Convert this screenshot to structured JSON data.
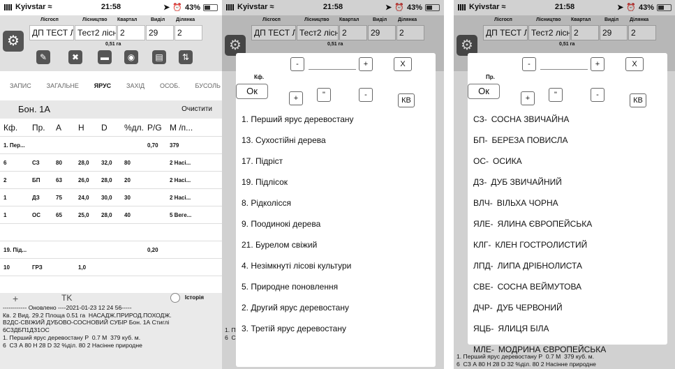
{
  "status": {
    "carrier": "Kyivstar",
    "time": "21:58",
    "battery": "43%"
  },
  "header": {
    "labels": [
      "Лісгосп",
      "Лісництво",
      "Квартал",
      "Виділ",
      "Ділянка"
    ],
    "values": [
      "ДП ТЕСТ Л",
      "Тест2 лісн",
      "2",
      "29",
      "2"
    ],
    "area": "0,51 га"
  },
  "tabs": [
    "ЗАПИС",
    "ЗАГАЛЬНЕ",
    "ЯРУС",
    "ЗАХІД",
    "ОСОБ.",
    "БУСОЛЬ"
  ],
  "stand": {
    "title": "Бон. 1А",
    "clear": "Очистити"
  },
  "grid": {
    "headers": [
      "Кф.",
      "Пр.",
      "А",
      "Н",
      "D",
      "%дл.",
      "P/G",
      "М /п..."
    ],
    "rows": [
      [
        "1. Пер...",
        "",
        "",
        "",
        "",
        "",
        "0,70",
        "379"
      ],
      [
        "6",
        "СЗ",
        "80",
        "28,0",
        "32,0",
        "80",
        "",
        "2 Насі..."
      ],
      [
        "2",
        "БП",
        "63",
        "26,0",
        "28,0",
        "20",
        "",
        "2 Насі..."
      ],
      [
        "1",
        "ДЗ",
        "75",
        "24,0",
        "30,0",
        "30",
        "",
        "2 Насі..."
      ],
      [
        "1",
        "ОС",
        "65",
        "25,0",
        "28,0",
        "40",
        "",
        "5 Веге..."
      ],
      [
        "",
        "",
        "",
        "",
        "",
        "",
        "",
        ""
      ],
      [
        "19. Під...",
        "",
        "",
        "",
        "",
        "",
        "0,20",
        ""
      ],
      [
        "10",
        "ГРЗ",
        "",
        "1,0",
        "",
        "",
        "",
        ""
      ]
    ]
  },
  "bottom": {
    "plus": "+",
    "tk": "TK",
    "history": "Історія",
    "log": [
      "------------ Оновлено ----2021-01-23 12 24 56-----",
      "Кв. 2 Вид. 29.2 Площа 0.51 га  НАСАДЖ.ПРИРОД.ПОХОДЖ.",
      "В2ДС-СВІЖИЙ ДУБОВО-СОСНОВИЙ СУБІР Бон. 1А Стиглі",
      "6С3ДБП1ДЗ1ОС",
      "1. Перший ярус деревостану Р  0.7 М  379 куб. м.",
      "6  СЗ А 80 Н 28 D 32 %діл. 80 2 Насінне природне"
    ]
  },
  "popup2": {
    "label": "Кф.",
    "ok": "Ок",
    "btn_minus": "-",
    "btn_plus": "+",
    "btn_x": "X",
    "btn_quote": "\"",
    "btn_kv": "КВ",
    "items": [
      "1. Перший ярус деревостану",
      "13. Сухостійні дерева",
      "17. Підріст",
      "19. Підлісок",
      "8. Рідколісся",
      "9. Поодинокі дерева",
      "21. Бурелом свіжий",
      "4. Незімкнуті лісові культури",
      "5. Природне поновлення",
      "2. Другий ярус деревостану",
      "3. Третій ярус деревостану"
    ]
  },
  "popup3": {
    "label": "Пр.",
    "ok": "Ок",
    "items": [
      {
        "code": "СЗ-",
        "name": "СОСНА ЗВИЧАЙНА"
      },
      {
        "code": "БП-",
        "name": "БЕРЕЗА ПОВИСЛА"
      },
      {
        "code": "ОС-",
        "name": "ОСИКА"
      },
      {
        "code": "ДЗ-",
        "name": "ДУБ ЗВИЧАЙНИЙ"
      },
      {
        "code": "ВЛЧ-",
        "name": "ВІЛЬХА ЧОРНА"
      },
      {
        "code": "ЯЛЕ-",
        "name": "ЯЛИНА ЄВРОПЕЙСЬКА"
      },
      {
        "code": "КЛГ-",
        "name": "КЛЕН ГОСТРОЛИСТИЙ"
      },
      {
        "code": "ЛПД-",
        "name": "ЛИПА ДРІБНОЛИСТА"
      },
      {
        "code": "СВЕ-",
        "name": "СОСНА ВЕЙМУТОВА"
      },
      {
        "code": "ДЧР-",
        "name": "ДУБ ЧЕРВОНИЙ"
      },
      {
        "code": "ЯЦБ-",
        "name": "ЯЛИЦЯ БІЛА"
      },
      {
        "code": "МЛЕ-",
        "name": "МОДРИНА ЄВРОПЕЙСЬКА"
      }
    ]
  }
}
